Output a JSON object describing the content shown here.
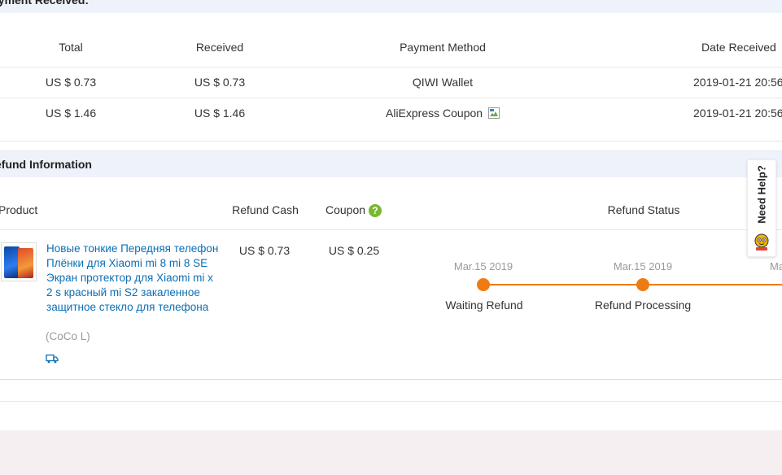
{
  "payment": {
    "header": "ayment Received:",
    "columns": {
      "total": "Total",
      "received": "Received",
      "method": "Payment Method",
      "date": "Date Received"
    },
    "rows": [
      {
        "total": "US $ 0.73",
        "received": "US $ 0.73",
        "method": "QIWI Wallet",
        "date": "2019-01-21 20:56"
      },
      {
        "total": "US $ 1.46",
        "received": "US $ 1.46",
        "method": "AliExpress Coupon",
        "date": "2019-01-21 20:56"
      }
    ]
  },
  "refund": {
    "header": "efund Information",
    "columns": {
      "product": "Product",
      "cash": "Refund Cash",
      "coupon": "Coupon",
      "status": "Refund Status"
    },
    "item": {
      "title": "Новые тонкие Передняя телефон Плёнки для Xiaomi mi 8 mi 8 SE Экран протектор для Xiaomi mi x 2 s красный mi S2 закаленное защитное стекло для телефона",
      "seller": "(CoCo L)",
      "cash": "US $ 0.73",
      "coupon": "US $ 0.25"
    },
    "timeline": [
      {
        "date": "Mar.15 2019",
        "label": "Waiting Refund"
      },
      {
        "date": "Mar.15 2019",
        "label": "Refund Processing"
      },
      {
        "date": "Mar"
      }
    ]
  },
  "need_help": {
    "label": "Need Help?"
  },
  "colors": {
    "accent": "#f07b10",
    "link": "#0a6fb5",
    "header_bg": "#eef3fb",
    "help_green": "#7ab82f"
  },
  "icons": [
    "broken-image-icon",
    "question-icon",
    "truck-icon",
    "mascot-icon"
  ]
}
